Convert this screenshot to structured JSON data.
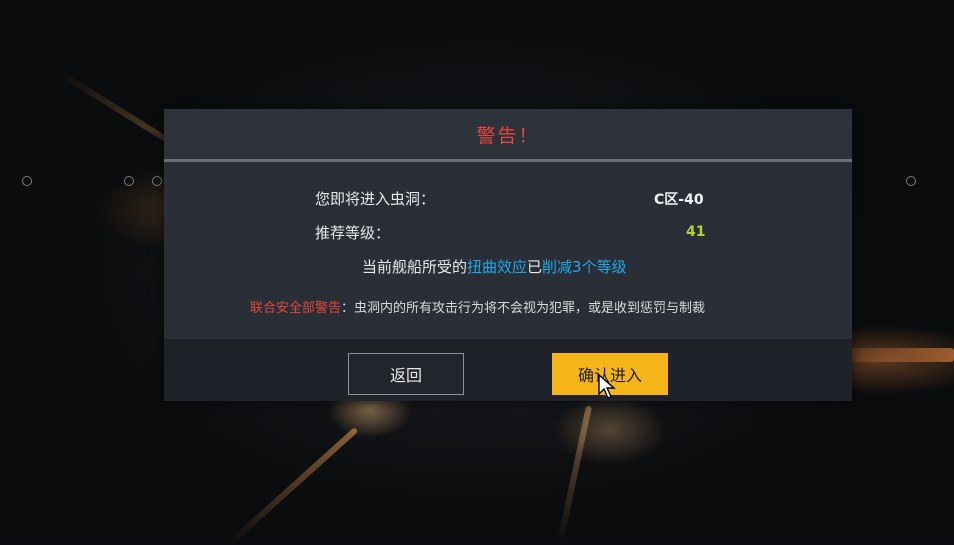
{
  "dialog": {
    "title": "警告！",
    "wormhole_label": "您即将进入虫洞：",
    "wormhole_value": "C区-40",
    "level_label": "推荐等级：",
    "level_value": "41",
    "effect_prefix": "当前舰船所受的",
    "effect_name": "扭曲效应",
    "effect_mid": "已",
    "effect_result": "削减3个等级",
    "warning_source": "联合安全部警告",
    "warning_text": "：虫洞内的所有攻击行为将不会视为犯罪，或是收到惩罚与制裁"
  },
  "buttons": {
    "back_label": "返回",
    "confirm_label": "确认进入"
  },
  "colors": {
    "title_red": "#e2463e",
    "highlight_blue": "#1fa8e8",
    "level_green": "#b5d22d",
    "warning_red": "#e2463e",
    "confirm_yellow": "#f5b418"
  },
  "icons": {
    "cursor": "mouse-pointer-icon"
  }
}
